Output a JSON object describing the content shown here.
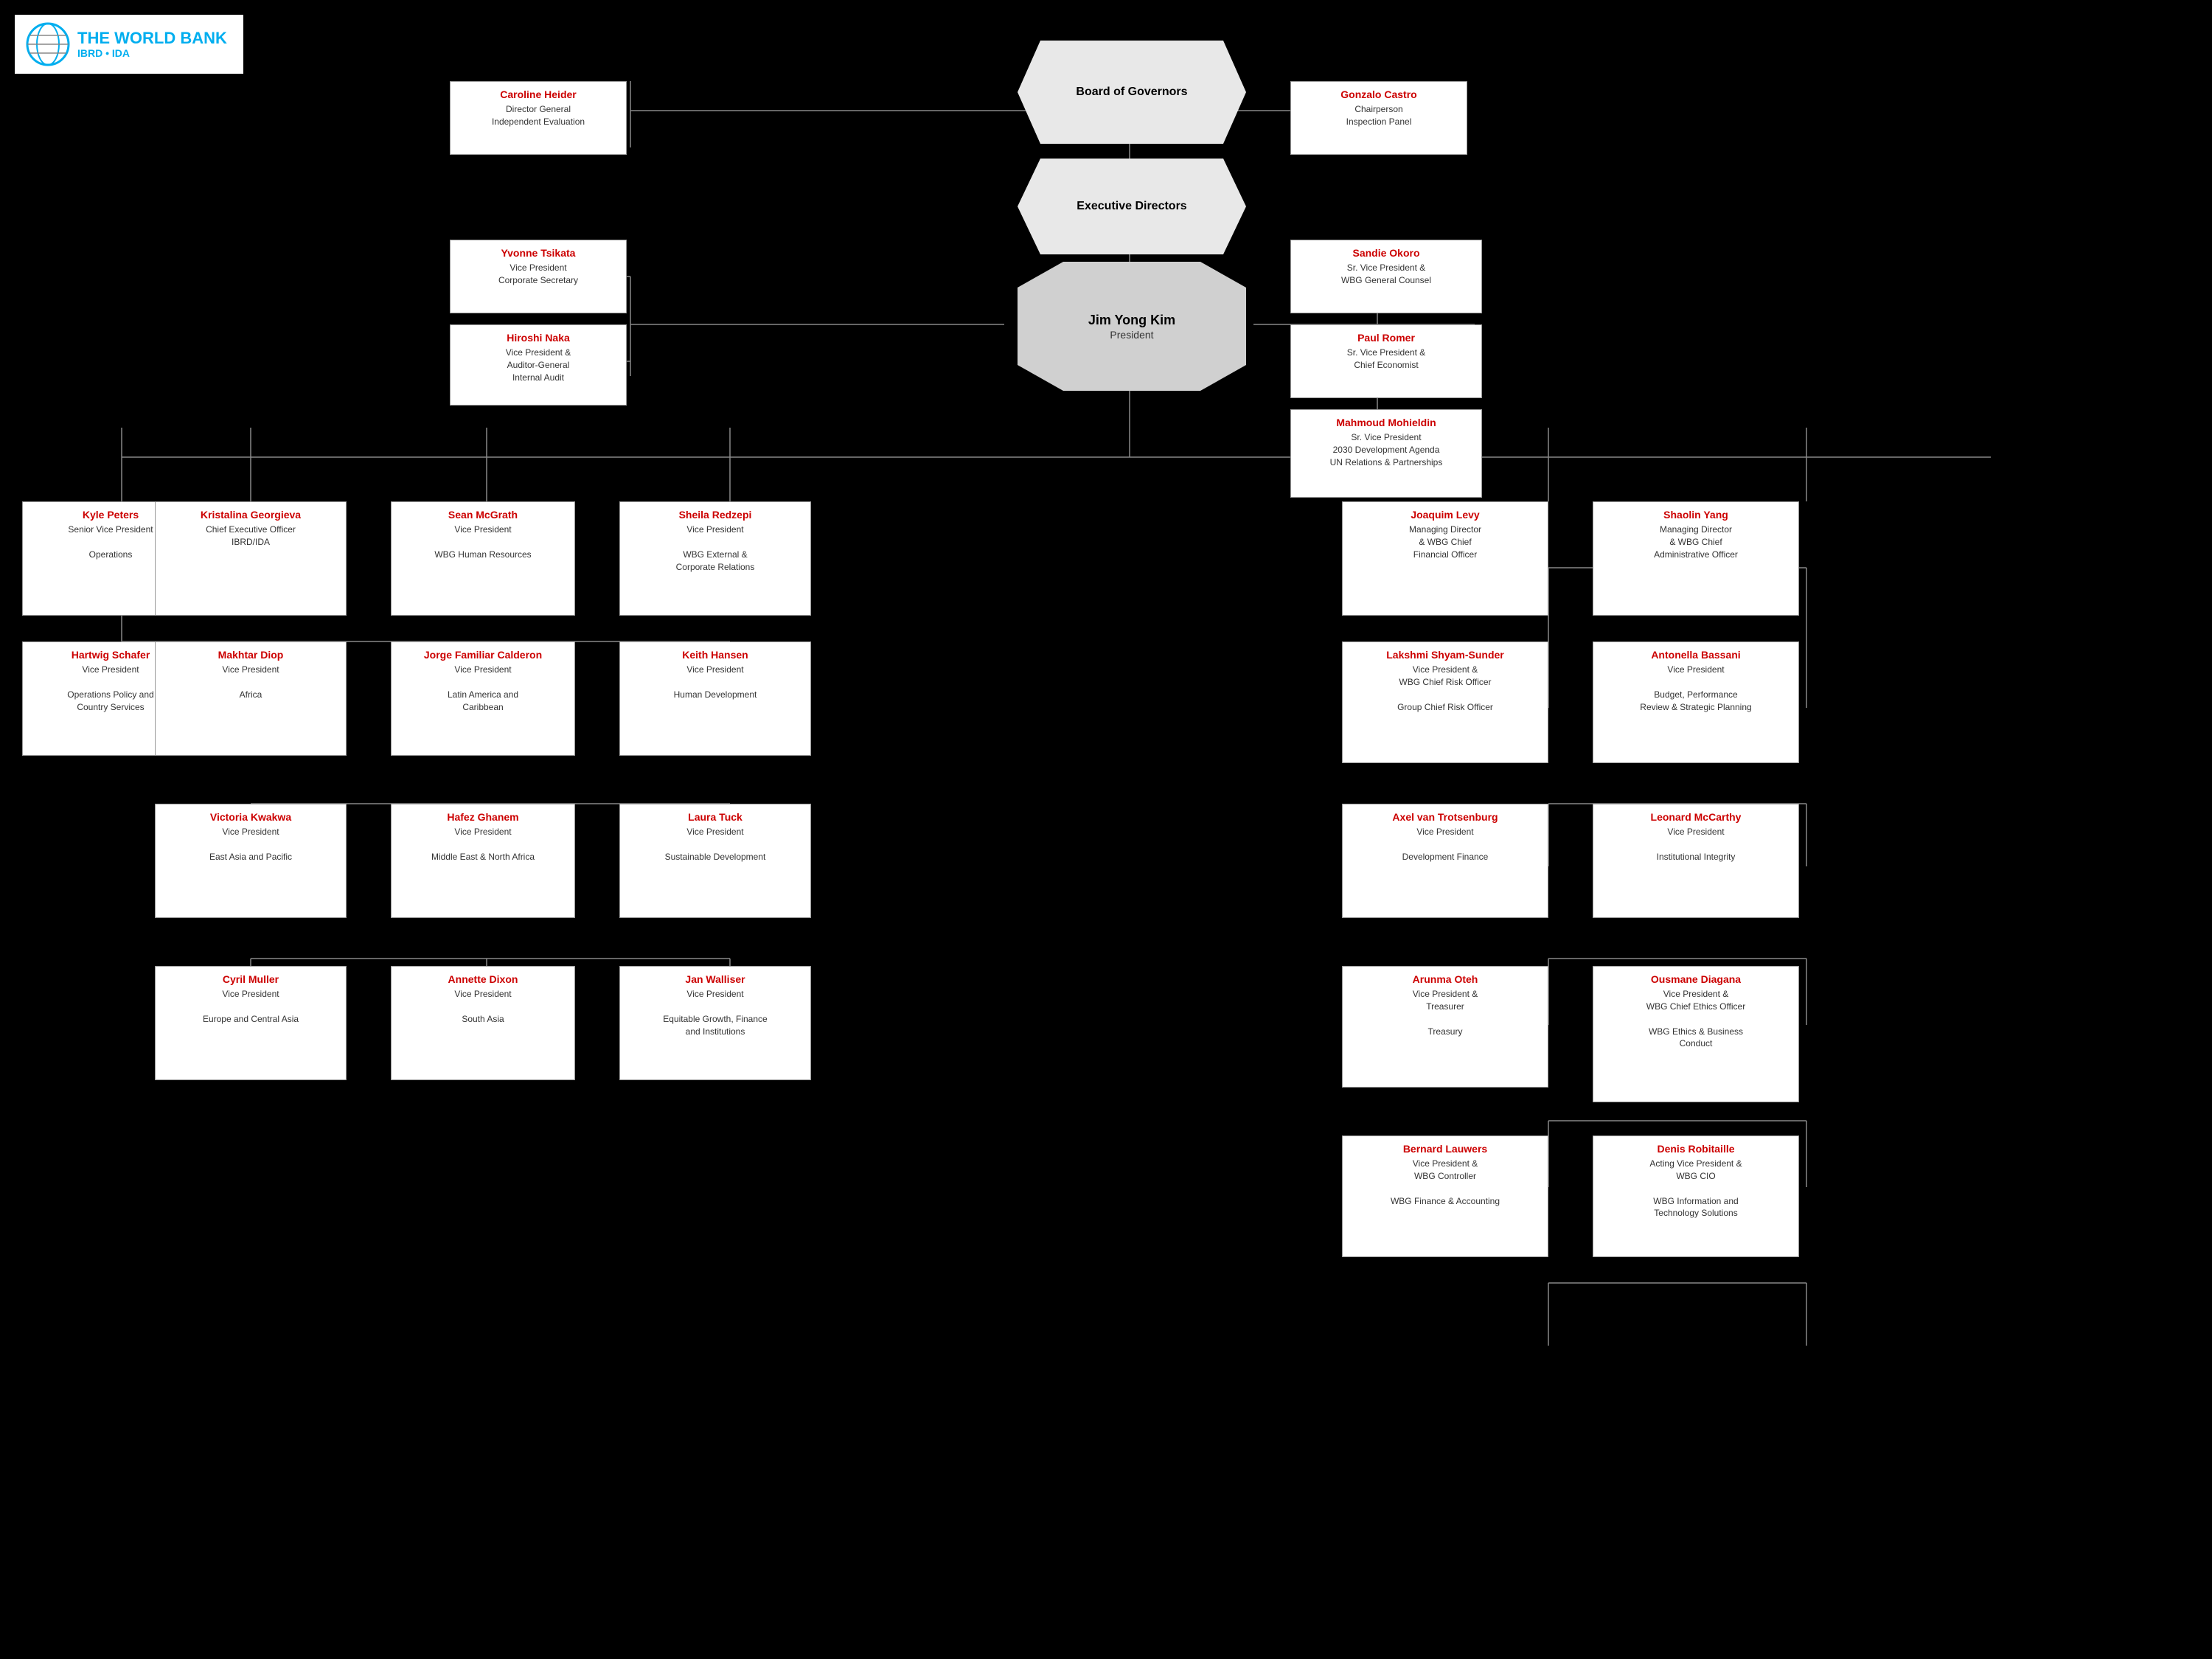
{
  "logo": {
    "name": "THE WORLD BANK",
    "sub": "IBRD • IDA"
  },
  "board_of_governors": {
    "label": "Board of Governors"
  },
  "executive_directors": {
    "label": "Executive Directors"
  },
  "president": {
    "name": "Jim Yong Kim",
    "title": "President"
  },
  "boxes": {
    "caroline": {
      "name": "Caroline Heider",
      "title": "Director General\nIndependent Evaluation"
    },
    "gonzalo": {
      "name": "Gonzalo Castro",
      "title": "Chairperson\nInspection Panel"
    },
    "yvonne": {
      "name": "Yvonne Tsikata",
      "title": "Vice President\nCorporate Secretary"
    },
    "sandie": {
      "name": "Sandie Okoro",
      "title": "Sr. Vice President &\nWBG General Counsel"
    },
    "paul": {
      "name": "Paul Romer",
      "title": "Sr. Vice President &\nChief Economist"
    },
    "hiroshi": {
      "name": "Hiroshi Naka",
      "title": "Vice President &\nAuditor-General\nInternal Audit"
    },
    "mahmoud": {
      "name": "Mahmoud Mohieldin",
      "title": "Sr. Vice President\n2030 Development Agenda\nUN Relations & Partnerships"
    },
    "kyle": {
      "name": "Kyle Peters",
      "title": "Senior Vice President\n\nOperations"
    },
    "kristalina": {
      "name": "Kristalina Georgieva",
      "title": "Chief Executive Officer\nIBRD/IDA"
    },
    "sean": {
      "name": "Sean McGrath",
      "title": "Vice President\n\nWBG Human Resources"
    },
    "sheila": {
      "name": "Sheila Redzepi",
      "title": "Vice President\n\nWBG External &\nCorporate Relations"
    },
    "joaquim": {
      "name": "Joaquim Levy",
      "title": "Managing Director\n& WBG Chief\nFinancial Officer"
    },
    "shaolin": {
      "name": "Shaolin Yang",
      "title": "Managing Director\n& WBG Chief\nAdministrative Officer"
    },
    "hartwig": {
      "name": "Hartwig Schafer",
      "title": "Vice President\n\nOperations Policy and\nCountry Services"
    },
    "makhtar": {
      "name": "Makhtar Diop",
      "title": "Vice President\n\nAfrica"
    },
    "jorge": {
      "name": "Jorge Familiar Calderon",
      "title": "Vice President\n\nLatin America and\nCaribbean"
    },
    "keith": {
      "name": "Keith Hansen",
      "title": "Vice President\n\nHuman Development"
    },
    "lakshmi": {
      "name": "Lakshmi Shyam-Sunder",
      "title": "Vice President &\nWBG Chief Risk Officer\n\nGroup Chief Risk Officer"
    },
    "antonella": {
      "name": "Antonella Bassani",
      "title": "Vice President\n\nBudget, Performance\nReview & Strategic Planning"
    },
    "victoria": {
      "name": "Victoria Kwakwa",
      "title": "Vice President\n\nEast Asia and Pacific"
    },
    "hafez": {
      "name": "Hafez Ghanem",
      "title": "Vice President\n\nMiddle East & North Africa"
    },
    "laura": {
      "name": "Laura Tuck",
      "title": "Vice President\n\nSustainable Development"
    },
    "axel": {
      "name": "Axel van Trotsenburg",
      "title": "Vice President\n\nDevelopment Finance"
    },
    "leonard": {
      "name": "Leonard McCarthy",
      "title": "Vice President\n\nInstitutional Integrity"
    },
    "cyril": {
      "name": "Cyril Muller",
      "title": "Vice President\n\nEurope and Central Asia"
    },
    "annette": {
      "name": "Annette Dixon",
      "title": "Vice President\n\nSouth Asia"
    },
    "jan": {
      "name": "Jan Walliser",
      "title": "Vice President\n\nEquitable Growth, Finance\nand Institutions"
    },
    "arunma": {
      "name": "Arunma Oteh",
      "title": "Vice President &\nTreasurer\n\nTreasury"
    },
    "ousmane": {
      "name": "Ousmane Diagana",
      "title": "Vice President  &\nWBG Chief Ethics Officer\n\nWBG Ethics & Business\nConduct"
    },
    "bernard": {
      "name": "Bernard Lauwers",
      "title": "Vice President &\nWBG Controller\n\nWBG Finance & Accounting"
    },
    "denis": {
      "name": "Denis Robitaille",
      "title": "Acting Vice President &\nWBG CIO\n\nWBG Information and\nTechnology Solutions"
    }
  }
}
